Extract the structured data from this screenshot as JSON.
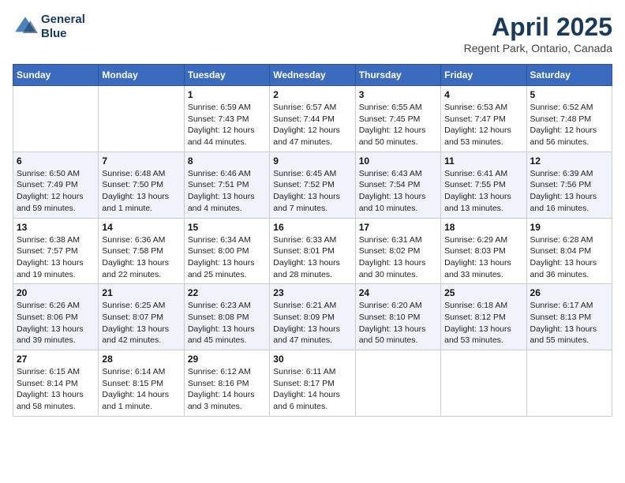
{
  "header": {
    "logo_line1": "General",
    "logo_line2": "Blue",
    "month_title": "April 2025",
    "location": "Regent Park, Ontario, Canada"
  },
  "weekdays": [
    "Sunday",
    "Monday",
    "Tuesday",
    "Wednesday",
    "Thursday",
    "Friday",
    "Saturday"
  ],
  "weeks": [
    [
      {
        "day": "",
        "info": ""
      },
      {
        "day": "",
        "info": ""
      },
      {
        "day": "1",
        "info": "Sunrise: 6:59 AM\nSunset: 7:43 PM\nDaylight: 12 hours and 44 minutes."
      },
      {
        "day": "2",
        "info": "Sunrise: 6:57 AM\nSunset: 7:44 PM\nDaylight: 12 hours and 47 minutes."
      },
      {
        "day": "3",
        "info": "Sunrise: 6:55 AM\nSunset: 7:45 PM\nDaylight: 12 hours and 50 minutes."
      },
      {
        "day": "4",
        "info": "Sunrise: 6:53 AM\nSunset: 7:47 PM\nDaylight: 12 hours and 53 minutes."
      },
      {
        "day": "5",
        "info": "Sunrise: 6:52 AM\nSunset: 7:48 PM\nDaylight: 12 hours and 56 minutes."
      }
    ],
    [
      {
        "day": "6",
        "info": "Sunrise: 6:50 AM\nSunset: 7:49 PM\nDaylight: 12 hours and 59 minutes."
      },
      {
        "day": "7",
        "info": "Sunrise: 6:48 AM\nSunset: 7:50 PM\nDaylight: 13 hours and 1 minute."
      },
      {
        "day": "8",
        "info": "Sunrise: 6:46 AM\nSunset: 7:51 PM\nDaylight: 13 hours and 4 minutes."
      },
      {
        "day": "9",
        "info": "Sunrise: 6:45 AM\nSunset: 7:52 PM\nDaylight: 13 hours and 7 minutes."
      },
      {
        "day": "10",
        "info": "Sunrise: 6:43 AM\nSunset: 7:54 PM\nDaylight: 13 hours and 10 minutes."
      },
      {
        "day": "11",
        "info": "Sunrise: 6:41 AM\nSunset: 7:55 PM\nDaylight: 13 hours and 13 minutes."
      },
      {
        "day": "12",
        "info": "Sunrise: 6:39 AM\nSunset: 7:56 PM\nDaylight: 13 hours and 16 minutes."
      }
    ],
    [
      {
        "day": "13",
        "info": "Sunrise: 6:38 AM\nSunset: 7:57 PM\nDaylight: 13 hours and 19 minutes."
      },
      {
        "day": "14",
        "info": "Sunrise: 6:36 AM\nSunset: 7:58 PM\nDaylight: 13 hours and 22 minutes."
      },
      {
        "day": "15",
        "info": "Sunrise: 6:34 AM\nSunset: 8:00 PM\nDaylight: 13 hours and 25 minutes."
      },
      {
        "day": "16",
        "info": "Sunrise: 6:33 AM\nSunset: 8:01 PM\nDaylight: 13 hours and 28 minutes."
      },
      {
        "day": "17",
        "info": "Sunrise: 6:31 AM\nSunset: 8:02 PM\nDaylight: 13 hours and 30 minutes."
      },
      {
        "day": "18",
        "info": "Sunrise: 6:29 AM\nSunset: 8:03 PM\nDaylight: 13 hours and 33 minutes."
      },
      {
        "day": "19",
        "info": "Sunrise: 6:28 AM\nSunset: 8:04 PM\nDaylight: 13 hours and 36 minutes."
      }
    ],
    [
      {
        "day": "20",
        "info": "Sunrise: 6:26 AM\nSunset: 8:06 PM\nDaylight: 13 hours and 39 minutes."
      },
      {
        "day": "21",
        "info": "Sunrise: 6:25 AM\nSunset: 8:07 PM\nDaylight: 13 hours and 42 minutes."
      },
      {
        "day": "22",
        "info": "Sunrise: 6:23 AM\nSunset: 8:08 PM\nDaylight: 13 hours and 45 minutes."
      },
      {
        "day": "23",
        "info": "Sunrise: 6:21 AM\nSunset: 8:09 PM\nDaylight: 13 hours and 47 minutes."
      },
      {
        "day": "24",
        "info": "Sunrise: 6:20 AM\nSunset: 8:10 PM\nDaylight: 13 hours and 50 minutes."
      },
      {
        "day": "25",
        "info": "Sunrise: 6:18 AM\nSunset: 8:12 PM\nDaylight: 13 hours and 53 minutes."
      },
      {
        "day": "26",
        "info": "Sunrise: 6:17 AM\nSunset: 8:13 PM\nDaylight: 13 hours and 55 minutes."
      }
    ],
    [
      {
        "day": "27",
        "info": "Sunrise: 6:15 AM\nSunset: 8:14 PM\nDaylight: 13 hours and 58 minutes."
      },
      {
        "day": "28",
        "info": "Sunrise: 6:14 AM\nSunset: 8:15 PM\nDaylight: 14 hours and 1 minute."
      },
      {
        "day": "29",
        "info": "Sunrise: 6:12 AM\nSunset: 8:16 PM\nDaylight: 14 hours and 3 minutes."
      },
      {
        "day": "30",
        "info": "Sunrise: 6:11 AM\nSunset: 8:17 PM\nDaylight: 14 hours and 6 minutes."
      },
      {
        "day": "",
        "info": ""
      },
      {
        "day": "",
        "info": ""
      },
      {
        "day": "",
        "info": ""
      }
    ]
  ]
}
